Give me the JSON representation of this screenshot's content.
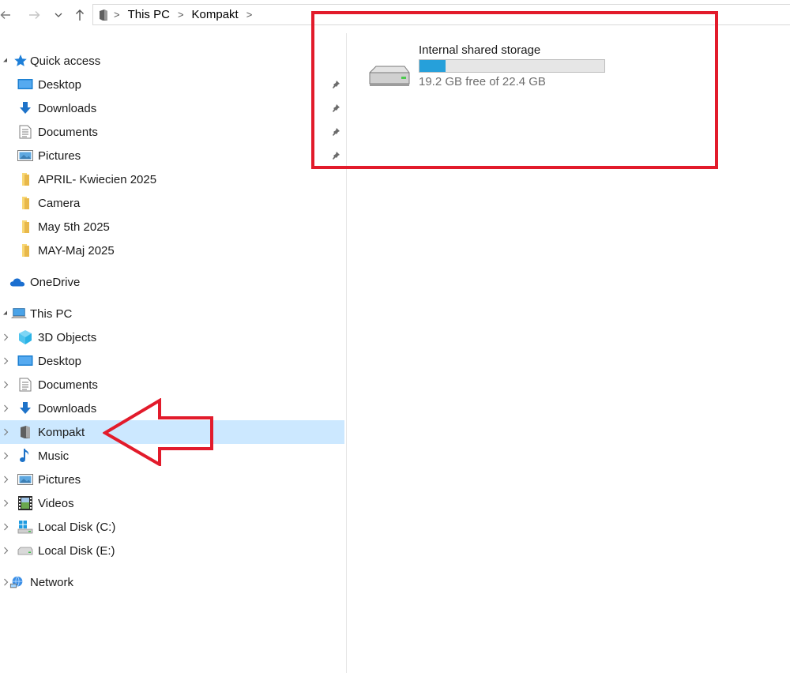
{
  "navigation": {
    "back_icon": "arrow-left-icon",
    "forward_icon": "arrow-right-icon",
    "recent_icon": "chevron-down-icon",
    "up_icon": "arrow-up-icon"
  },
  "breadcrumb": {
    "location_icon": "portable-device-icon",
    "items": [
      "This PC",
      "Kompakt"
    ],
    "separator": ">"
  },
  "nav_pane": {
    "quick_access": {
      "label": "Quick access",
      "expanded": true,
      "items": [
        {
          "label": "Desktop",
          "icon": "desktop-icon",
          "pinned": true
        },
        {
          "label": "Downloads",
          "icon": "downloads-icon",
          "pinned": true
        },
        {
          "label": "Documents",
          "icon": "documents-icon",
          "pinned": true
        },
        {
          "label": "Pictures",
          "icon": "pictures-icon",
          "pinned": true
        },
        {
          "label": "APRIL- Kwiecien 2025",
          "icon": "folder-icon"
        },
        {
          "label": "Camera",
          "icon": "folder-icon"
        },
        {
          "label": "May 5th 2025",
          "icon": "folder-icon"
        },
        {
          "label": "MAY-Maj 2025",
          "icon": "folder-icon"
        }
      ]
    },
    "onedrive": {
      "label": "OneDrive"
    },
    "this_pc": {
      "label": "This PC",
      "expanded": true,
      "items": [
        {
          "label": "3D Objects",
          "icon": "3d-objects-icon"
        },
        {
          "label": "Desktop",
          "icon": "desktop-icon"
        },
        {
          "label": "Documents",
          "icon": "documents-icon"
        },
        {
          "label": "Downloads",
          "icon": "downloads-icon"
        },
        {
          "label": "Kompakt",
          "icon": "portable-device-icon",
          "selected": true
        },
        {
          "label": "Music",
          "icon": "music-icon"
        },
        {
          "label": "Pictures",
          "icon": "pictures-icon"
        },
        {
          "label": "Videos",
          "icon": "videos-icon"
        },
        {
          "label": "Local Disk (C:)",
          "icon": "windows-drive-icon"
        },
        {
          "label": "Local Disk (E:)",
          "icon": "drive-icon"
        }
      ]
    },
    "network": {
      "label": "Network"
    }
  },
  "content": {
    "drive": {
      "name": "Internal shared storage",
      "free_text": "19.2 GB free of 22.4 GB",
      "used_fraction": 0.143,
      "icon": "hard-drive-icon"
    }
  },
  "colors": {
    "accent": "#26a0da",
    "selection": "#cce8ff",
    "annotation_red": "#e21b2b",
    "folder_yellow": "#f8d775"
  }
}
